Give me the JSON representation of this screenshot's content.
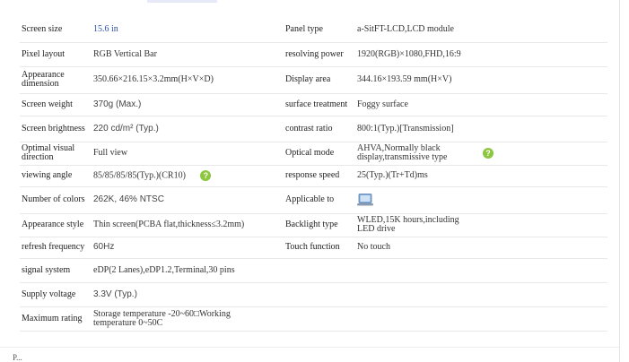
{
  "specs": [
    {
      "label": "Screen size",
      "value": "15.6 in",
      "label2": "Panel type",
      "value2": "a-SitFT-LCD,LCD module"
    },
    {
      "label": "Pixel layout",
      "value": "RGB Vertical Bar",
      "label2": "resolving power",
      "value2": "1920(RGB)×1080,FHD,16:9"
    },
    {
      "label": "Appearance dimension",
      "value": "350.66×216.15×3.2mm(H×V×D)",
      "label2": "Display area",
      "value2": "344.16×193.59 mm(H×V)"
    },
    {
      "label": "Screen weight",
      "value": "370g (Max.)",
      "label2": "surface treatment",
      "value2": "Foggy surface"
    },
    {
      "label": "Screen brightness",
      "value": "220 cd/m² (Typ.)",
      "label2": "contrast ratio",
      "value2": "800:1(Typ.)[Transmission]"
    },
    {
      "label": "Optimal visual direction",
      "value": "Full view",
      "label2": "Optical mode",
      "value2": "AHVA,Normally black display,transmissive type"
    },
    {
      "label": "viewing angle",
      "value": "85/85/85/85(Typ.)(CR10)",
      "label2": "response speed",
      "value2": "25(Typ.)(Tr+Td)ms"
    },
    {
      "label": "Number of colors",
      "value": "262K, 46% NTSC",
      "label2": "Applicable to",
      "value2": ""
    },
    {
      "label": "Appearance style",
      "value": "Thin screen(PCBA flat,thickness≤3.2mm)",
      "label2": "Backlight type",
      "value2": "WLED,15K hours,including LED drive"
    },
    {
      "label": "refresh frequency",
      "value": "60Hz",
      "label2": "Touch function",
      "value2": "No touch"
    },
    {
      "label": "signal system",
      "value": "eDP(2 Lanes),eDP1.2,Terminal,30 pins"
    },
    {
      "label": "Supply voltage",
      "value": "3.3V (Typ.)"
    },
    {
      "label": "Maximum rating",
      "value": "Storage temperature -20~60□Working temperature 0~50C"
    }
  ],
  "help_icon_glyph": "?",
  "footer": "P..."
}
